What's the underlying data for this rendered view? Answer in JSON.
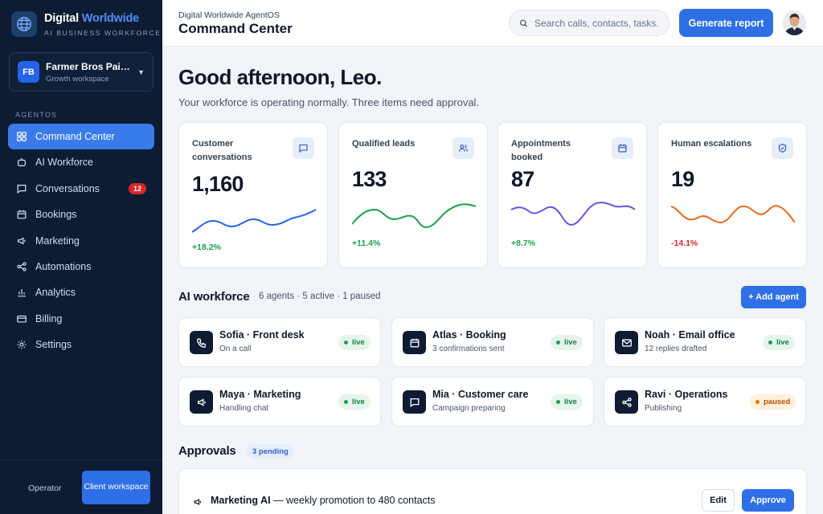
{
  "brand": {
    "name_part1": "Digital ",
    "name_part2": "Worldwide",
    "subtitle": "AI BUSINESS WORKFORCE"
  },
  "workspace": {
    "initials": "FB",
    "name": "Farmer Bros Painting",
    "plan": "Growth workspace"
  },
  "sidebar": {
    "section_label": "AGENTOS",
    "items": [
      {
        "label": "Command Center",
        "icon": "grid-icon",
        "active": true
      },
      {
        "label": "AI Workforce",
        "icon": "robot-icon"
      },
      {
        "label": "Conversations",
        "icon": "chat-icon",
        "badge": "12"
      },
      {
        "label": "Bookings",
        "icon": "calendar-icon"
      },
      {
        "label": "Marketing",
        "icon": "megaphone-icon"
      },
      {
        "label": "Automations",
        "icon": "share-icon"
      },
      {
        "label": "Analytics",
        "icon": "bar-chart-icon"
      },
      {
        "label": "Billing",
        "icon": "credit-card-icon"
      },
      {
        "label": "Settings",
        "icon": "gear-icon"
      }
    ],
    "footer": {
      "operator_label": "Operator",
      "client_button_label": "Client workspace"
    }
  },
  "header": {
    "breadcrumb": "Digital Worldwide AgentOS",
    "title": "Command Center",
    "search_placeholder": "Search calls, contacts, tasks...",
    "generate_button": "Generate report"
  },
  "main": {
    "greeting": "Good afternoon, Leo.",
    "subtitle": "Your workforce is operating normally. Three items need approval."
  },
  "kpis": [
    {
      "label": "Customer conversations",
      "value": "1,160",
      "delta": "+18.2%",
      "icon": "chat-icon",
      "color": "#2563eb",
      "delta_color": "#16a34a"
    },
    {
      "label": "Qualified leads",
      "value": "133",
      "delta": "+11.4%",
      "icon": "users-icon",
      "color": "#16a34a",
      "delta_color": "#16a34a"
    },
    {
      "label": "Appointments booked",
      "value": "87",
      "delta": "+8.7%",
      "icon": "calendar-icon",
      "color": "#6d4fe6",
      "delta_color": "#16a34a"
    },
    {
      "label": "Human escalations",
      "value": "19",
      "delta": "-14.1%",
      "icon": "shield-icon",
      "color": "#ea6a1a",
      "delta_color": "#dc2626"
    }
  ],
  "workforce": {
    "title": "AI workforce",
    "meta": "6 agents · 5 active · 1 paused",
    "add_button": "+ Add agent",
    "agents": [
      {
        "name": "Sofia · Front desk",
        "status": "On a call",
        "badge": "live",
        "icon": "phone-icon"
      },
      {
        "name": "Atlas · Booking",
        "status": "3 confirmations sent",
        "badge": "live",
        "icon": "calendar-icon"
      },
      {
        "name": "Noah · Email office",
        "status": "12 replies drafted",
        "badge": "live",
        "icon": "mail-icon"
      },
      {
        "name": "Maya · Marketing",
        "status": "Handling chat",
        "badge": "live",
        "icon": "megaphone-icon"
      },
      {
        "name": "Mia · Customer care",
        "status": "Campaign preparing",
        "badge": "live",
        "icon": "chat-icon"
      },
      {
        "name": "Ravi · Operations",
        "status": "Publishing",
        "badge": "paused",
        "icon": "share-icon"
      }
    ]
  },
  "approvals": {
    "title": "Approvals",
    "pending": "3 pending",
    "items": [
      {
        "agent": "Marketing AI",
        "text": " — weekly promotion to 480 contacts",
        "edit": "Edit",
        "approve": "Approve"
      }
    ]
  }
}
